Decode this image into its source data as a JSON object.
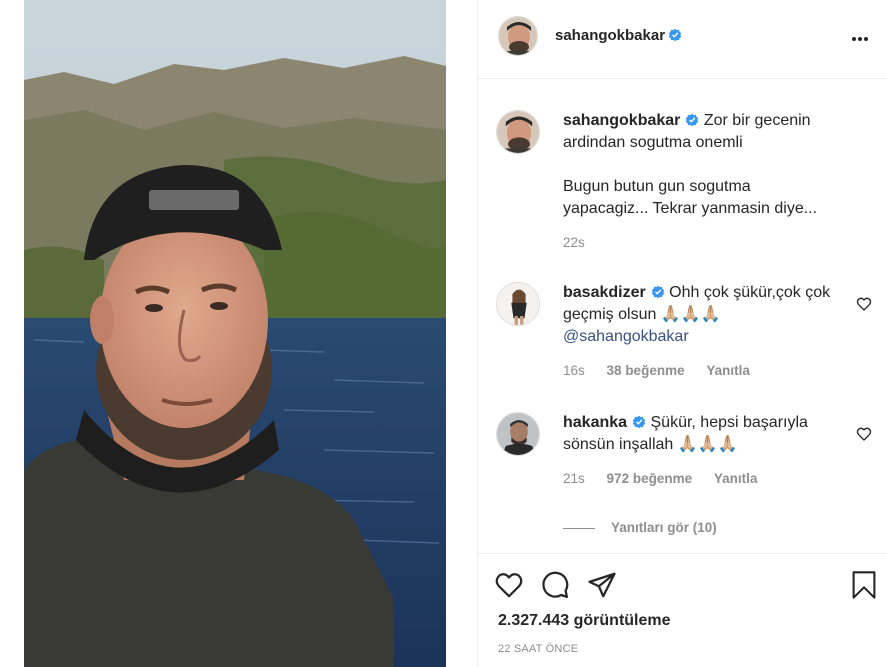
{
  "post": {
    "author": "sahangokbakar",
    "verified": true
  },
  "caption": {
    "username": "sahangokbakar",
    "line1": "Zor bir gecenin ardindan sogutma onemli",
    "line2": "Bugun butun gun sogutma yapacagiz... Tekrar yanmasin diye...",
    "time": "22s"
  },
  "comments": [
    {
      "username": "basakdizer",
      "text": "Ohh çok şükür,çok çok geçmiş olsun 🙏🏼🙏🏼🙏🏼",
      "mention": "@sahangokbakar",
      "time": "16s",
      "likes": "38 beğenme",
      "reply": "Yanıtla"
    },
    {
      "username": "hakanka",
      "text": "Şükür, hepsi başarıyla sönsün inşallah 🙏🏼🙏🏼🙏🏼",
      "time": "21s",
      "likes": "972 beğenme",
      "reply": "Yanıtla"
    }
  ],
  "view_replies": "Yanıtları gör (10)",
  "footer": {
    "views": "2.327.443 görüntüleme",
    "ago": "22 SAAT ÖNCE"
  },
  "icons": {
    "verified": "verified-badge-icon",
    "more": "more-options-icon",
    "like": "heart-icon",
    "comment": "comment-icon",
    "share": "share-icon",
    "save": "bookmark-icon"
  },
  "colors": {
    "verified": "#3897f0",
    "link": "#385185",
    "muted": "#8e8e8e",
    "text": "#262626"
  }
}
